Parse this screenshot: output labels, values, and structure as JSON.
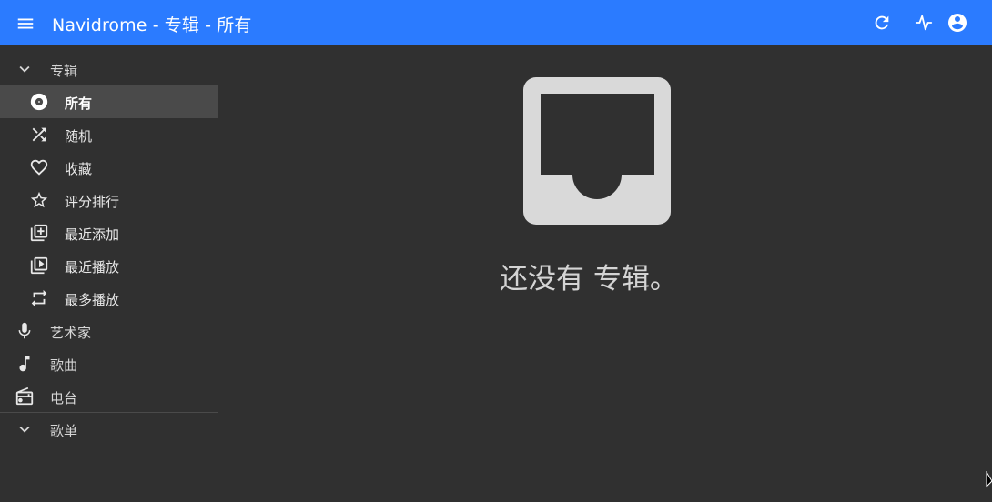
{
  "appbar": {
    "title": "Navidrome - 专辑 - 所有",
    "background": "#2b7bff",
    "menu_icon": "hamburger-menu-icon",
    "actions": [
      "refresh-icon",
      "activity-icon",
      "account-circle-icon"
    ]
  },
  "sidebar": {
    "albums_header": {
      "label": "专辑",
      "icon": "chevron-down-icon"
    },
    "album_items": [
      {
        "label": "所有",
        "icon": "album-disc-icon",
        "active": true
      },
      {
        "label": "随机",
        "icon": "shuffle-icon"
      },
      {
        "label": "收藏",
        "icon": "heart-icon"
      },
      {
        "label": "评分排行",
        "icon": "star-icon"
      },
      {
        "label": "最近添加",
        "icon": "library-add-icon"
      },
      {
        "label": "最近播放",
        "icon": "library-play-icon"
      },
      {
        "label": "最多播放",
        "icon": "repeat-icon"
      }
    ],
    "top_items": [
      {
        "label": "艺术家",
        "icon": "microphone-icon"
      },
      {
        "label": "歌曲",
        "icon": "music-note-icon"
      },
      {
        "label": "电台",
        "icon": "radio-icon"
      }
    ],
    "playlists_header": {
      "label": "歌单",
      "icon": "chevron-down-icon"
    }
  },
  "main": {
    "empty_icon": "inbox-empty-icon",
    "empty_message": "还没有 专辑。"
  }
}
